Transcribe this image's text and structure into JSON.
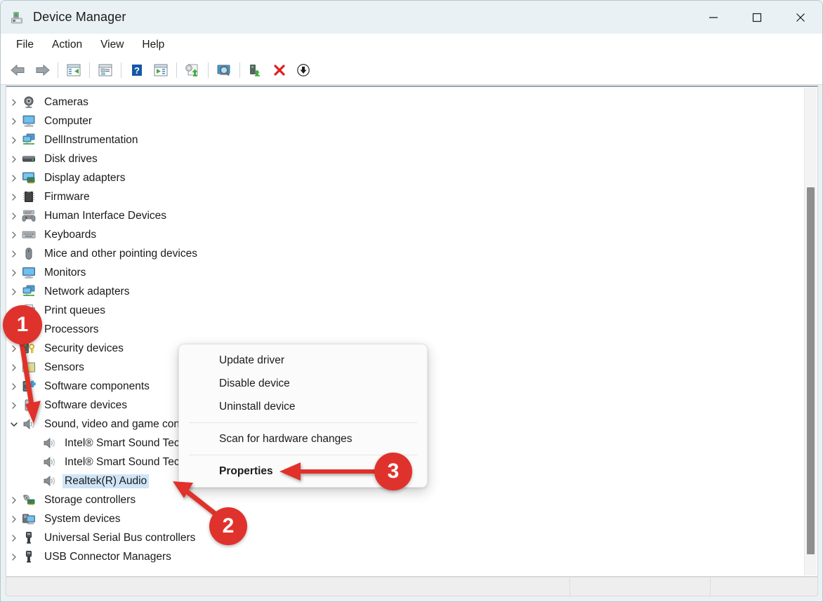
{
  "window": {
    "title": "Device Manager",
    "icon": "device-manager-icon",
    "controls": [
      {
        "name": "minimize-button",
        "glyph": "minimize"
      },
      {
        "name": "maximize-button",
        "glyph": "maximize"
      },
      {
        "name": "close-button",
        "glyph": "close"
      }
    ]
  },
  "menubar": {
    "items": [
      {
        "label": "File"
      },
      {
        "label": "Action"
      },
      {
        "label": "View"
      },
      {
        "label": "Help"
      }
    ]
  },
  "toolbar": {
    "buttons": [
      {
        "name": "back-button",
        "icon": "back-arrow-icon"
      },
      {
        "name": "forward-button",
        "icon": "forward-arrow-icon"
      },
      {
        "name": "show-hide-console-tree-button",
        "icon": "console-tree-icon"
      },
      {
        "name": "properties-button",
        "icon": "properties-window-icon"
      },
      {
        "name": "help-button",
        "icon": "question-mark-icon"
      },
      {
        "name": "show-hide-action-pane-button",
        "icon": "action-pane-icon"
      },
      {
        "name": "update-driver-button",
        "icon": "update-driver-icon"
      },
      {
        "name": "scan-for-hardware-changes-button",
        "icon": "scan-hardware-icon"
      },
      {
        "name": "enable-device-button",
        "icon": "enable-device-icon"
      },
      {
        "name": "uninstall-device-button",
        "icon": "red-x-icon"
      },
      {
        "name": "disable-device-button",
        "icon": "down-arrow-circle-icon"
      }
    ]
  },
  "tree": {
    "rows": [
      {
        "label": "Cameras",
        "icon": "camera-icon",
        "expander": "collapsed",
        "level": 0,
        "selected": false
      },
      {
        "label": "Computer",
        "icon": "computer-icon",
        "expander": "collapsed",
        "level": 0,
        "selected": false
      },
      {
        "label": "DellInstrumentation",
        "icon": "network-computers-icon",
        "expander": "collapsed",
        "level": 0,
        "selected": false
      },
      {
        "label": "Disk drives",
        "icon": "disk-drive-icon",
        "expander": "collapsed",
        "level": 0,
        "selected": false
      },
      {
        "label": "Display adapters",
        "icon": "display-adapter-icon",
        "expander": "collapsed",
        "level": 0,
        "selected": false
      },
      {
        "label": "Firmware",
        "icon": "firmware-chip-icon",
        "expander": "collapsed",
        "level": 0,
        "selected": false
      },
      {
        "label": "Human Interface Devices",
        "icon": "hid-gamepad-icon",
        "expander": "collapsed",
        "level": 0,
        "selected": false
      },
      {
        "label": "Keyboards",
        "icon": "keyboard-icon",
        "expander": "collapsed",
        "level": 0,
        "selected": false
      },
      {
        "label": "Mice and other pointing devices",
        "icon": "mouse-icon",
        "expander": "collapsed",
        "level": 0,
        "selected": false
      },
      {
        "label": "Monitors",
        "icon": "monitor-icon",
        "expander": "collapsed",
        "level": 0,
        "selected": false
      },
      {
        "label": "Network adapters",
        "icon": "network-adapter-icon",
        "expander": "collapsed",
        "level": 0,
        "selected": false
      },
      {
        "label": "Print queues",
        "icon": "printer-icon",
        "expander": "collapsed",
        "level": 0,
        "selected": false
      },
      {
        "label": "Processors",
        "icon": "processor-icon",
        "expander": "collapsed",
        "level": 0,
        "selected": false
      },
      {
        "label": "Security devices",
        "icon": "security-device-icon",
        "expander": "collapsed",
        "level": 0,
        "selected": false
      },
      {
        "label": "Sensors",
        "icon": "sensors-icon",
        "expander": "collapsed",
        "level": 0,
        "selected": false
      },
      {
        "label": "Software components",
        "icon": "software-component-icon",
        "expander": "collapsed",
        "level": 0,
        "selected": false
      },
      {
        "label": "Software devices",
        "icon": "software-device-icon",
        "expander": "collapsed",
        "level": 0,
        "selected": false
      },
      {
        "label": "Sound, video and game controllers",
        "icon": "speaker-icon",
        "expander": "expanded",
        "level": 0,
        "selected": false
      },
      {
        "label": "Intel® Smart Sound Technology for Bluetooth®",
        "icon": "speaker-icon",
        "expander": "none",
        "level": 1,
        "selected": false
      },
      {
        "label": "Intel® Smart Sound Technology for USB Audio",
        "icon": "speaker-icon",
        "expander": "none",
        "level": 1,
        "selected": false
      },
      {
        "label": "Realtek(R) Audio",
        "icon": "speaker-icon",
        "expander": "none",
        "level": 1,
        "selected": true
      },
      {
        "label": "Storage controllers",
        "icon": "storage-controller-icon",
        "expander": "collapsed",
        "level": 0,
        "selected": false
      },
      {
        "label": "System devices",
        "icon": "system-device-icon",
        "expander": "collapsed",
        "level": 0,
        "selected": false
      },
      {
        "label": "Universal Serial Bus controllers",
        "icon": "usb-icon",
        "expander": "collapsed",
        "level": 0,
        "selected": false
      },
      {
        "label": "USB Connector Managers",
        "icon": "usb-icon",
        "expander": "collapsed",
        "level": 0,
        "selected": false
      }
    ]
  },
  "context_menu": {
    "items": [
      {
        "label": "Update driver",
        "bold": false,
        "separator_after": false
      },
      {
        "label": "Disable device",
        "bold": false,
        "separator_after": false
      },
      {
        "label": "Uninstall device",
        "bold": false,
        "separator_after": true
      },
      {
        "label": "Scan for hardware changes",
        "bold": false,
        "separator_after": true
      },
      {
        "label": "Properties",
        "bold": true,
        "separator_after": false
      }
    ]
  },
  "annotations": {
    "accent_color": "#e0322c",
    "badges": [
      {
        "label": "1"
      },
      {
        "label": "2"
      },
      {
        "label": "3"
      }
    ]
  },
  "statusbar": {
    "panes": [
      "",
      "",
      ""
    ]
  }
}
